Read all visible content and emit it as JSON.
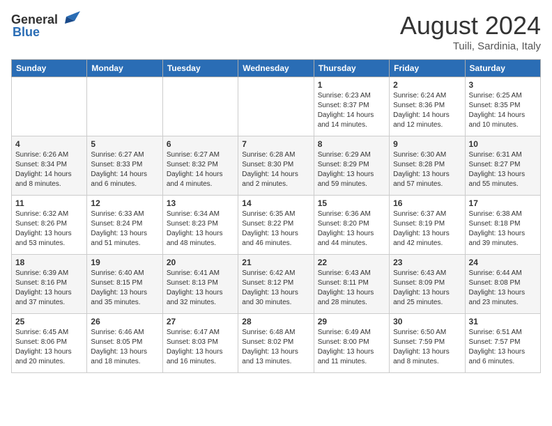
{
  "logo": {
    "general": "General",
    "blue": "Blue"
  },
  "header": {
    "month": "August 2024",
    "location": "Tuili, Sardinia, Italy"
  },
  "weekdays": [
    "Sunday",
    "Monday",
    "Tuesday",
    "Wednesday",
    "Thursday",
    "Friday",
    "Saturday"
  ],
  "weeks": [
    [
      {
        "day": "",
        "info": ""
      },
      {
        "day": "",
        "info": ""
      },
      {
        "day": "",
        "info": ""
      },
      {
        "day": "",
        "info": ""
      },
      {
        "day": "1",
        "info": "Sunrise: 6:23 AM\nSunset: 8:37 PM\nDaylight: 14 hours\nand 14 minutes."
      },
      {
        "day": "2",
        "info": "Sunrise: 6:24 AM\nSunset: 8:36 PM\nDaylight: 14 hours\nand 12 minutes."
      },
      {
        "day": "3",
        "info": "Sunrise: 6:25 AM\nSunset: 8:35 PM\nDaylight: 14 hours\nand 10 minutes."
      }
    ],
    [
      {
        "day": "4",
        "info": "Sunrise: 6:26 AM\nSunset: 8:34 PM\nDaylight: 14 hours\nand 8 minutes."
      },
      {
        "day": "5",
        "info": "Sunrise: 6:27 AM\nSunset: 8:33 PM\nDaylight: 14 hours\nand 6 minutes."
      },
      {
        "day": "6",
        "info": "Sunrise: 6:27 AM\nSunset: 8:32 PM\nDaylight: 14 hours\nand 4 minutes."
      },
      {
        "day": "7",
        "info": "Sunrise: 6:28 AM\nSunset: 8:30 PM\nDaylight: 14 hours\nand 2 minutes."
      },
      {
        "day": "8",
        "info": "Sunrise: 6:29 AM\nSunset: 8:29 PM\nDaylight: 13 hours\nand 59 minutes."
      },
      {
        "day": "9",
        "info": "Sunrise: 6:30 AM\nSunset: 8:28 PM\nDaylight: 13 hours\nand 57 minutes."
      },
      {
        "day": "10",
        "info": "Sunrise: 6:31 AM\nSunset: 8:27 PM\nDaylight: 13 hours\nand 55 minutes."
      }
    ],
    [
      {
        "day": "11",
        "info": "Sunrise: 6:32 AM\nSunset: 8:26 PM\nDaylight: 13 hours\nand 53 minutes."
      },
      {
        "day": "12",
        "info": "Sunrise: 6:33 AM\nSunset: 8:24 PM\nDaylight: 13 hours\nand 51 minutes."
      },
      {
        "day": "13",
        "info": "Sunrise: 6:34 AM\nSunset: 8:23 PM\nDaylight: 13 hours\nand 48 minutes."
      },
      {
        "day": "14",
        "info": "Sunrise: 6:35 AM\nSunset: 8:22 PM\nDaylight: 13 hours\nand 46 minutes."
      },
      {
        "day": "15",
        "info": "Sunrise: 6:36 AM\nSunset: 8:20 PM\nDaylight: 13 hours\nand 44 minutes."
      },
      {
        "day": "16",
        "info": "Sunrise: 6:37 AM\nSunset: 8:19 PM\nDaylight: 13 hours\nand 42 minutes."
      },
      {
        "day": "17",
        "info": "Sunrise: 6:38 AM\nSunset: 8:18 PM\nDaylight: 13 hours\nand 39 minutes."
      }
    ],
    [
      {
        "day": "18",
        "info": "Sunrise: 6:39 AM\nSunset: 8:16 PM\nDaylight: 13 hours\nand 37 minutes."
      },
      {
        "day": "19",
        "info": "Sunrise: 6:40 AM\nSunset: 8:15 PM\nDaylight: 13 hours\nand 35 minutes."
      },
      {
        "day": "20",
        "info": "Sunrise: 6:41 AM\nSunset: 8:13 PM\nDaylight: 13 hours\nand 32 minutes."
      },
      {
        "day": "21",
        "info": "Sunrise: 6:42 AM\nSunset: 8:12 PM\nDaylight: 13 hours\nand 30 minutes."
      },
      {
        "day": "22",
        "info": "Sunrise: 6:43 AM\nSunset: 8:11 PM\nDaylight: 13 hours\nand 28 minutes."
      },
      {
        "day": "23",
        "info": "Sunrise: 6:43 AM\nSunset: 8:09 PM\nDaylight: 13 hours\nand 25 minutes."
      },
      {
        "day": "24",
        "info": "Sunrise: 6:44 AM\nSunset: 8:08 PM\nDaylight: 13 hours\nand 23 minutes."
      }
    ],
    [
      {
        "day": "25",
        "info": "Sunrise: 6:45 AM\nSunset: 8:06 PM\nDaylight: 13 hours\nand 20 minutes."
      },
      {
        "day": "26",
        "info": "Sunrise: 6:46 AM\nSunset: 8:05 PM\nDaylight: 13 hours\nand 18 minutes."
      },
      {
        "day": "27",
        "info": "Sunrise: 6:47 AM\nSunset: 8:03 PM\nDaylight: 13 hours\nand 16 minutes."
      },
      {
        "day": "28",
        "info": "Sunrise: 6:48 AM\nSunset: 8:02 PM\nDaylight: 13 hours\nand 13 minutes."
      },
      {
        "day": "29",
        "info": "Sunrise: 6:49 AM\nSunset: 8:00 PM\nDaylight: 13 hours\nand 11 minutes."
      },
      {
        "day": "30",
        "info": "Sunrise: 6:50 AM\nSunset: 7:59 PM\nDaylight: 13 hours\nand 8 minutes."
      },
      {
        "day": "31",
        "info": "Sunrise: 6:51 AM\nSunset: 7:57 PM\nDaylight: 13 hours\nand 6 minutes."
      }
    ]
  ]
}
